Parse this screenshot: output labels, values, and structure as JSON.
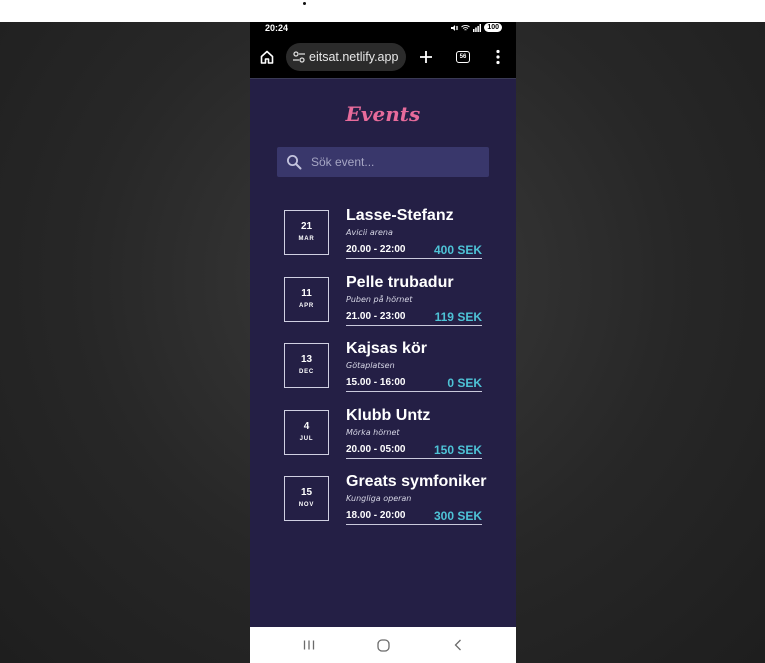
{
  "status_bar": {
    "time": "20:24",
    "battery": "100"
  },
  "browser": {
    "url": "eitsat.netlify.app",
    "tab_count": "56"
  },
  "page": {
    "heading": "Events",
    "search_placeholder": "Sök event..."
  },
  "events": [
    {
      "day": "21",
      "month": "MAR",
      "title": "Lasse-Stefanz",
      "venue": "Avicii arena",
      "time": "20.00 - 22:00",
      "price": "400 SEK"
    },
    {
      "day": "11",
      "month": "APR",
      "title": "Pelle trubadur",
      "venue": "Puben på hörnet",
      "time": "21.00 - 23:00",
      "price": "119 SEK"
    },
    {
      "day": "13",
      "month": "DEC",
      "title": "Kajsas kör",
      "venue": "Götaplatsen",
      "time": "15.00 - 16:00",
      "price": "0 SEK"
    },
    {
      "day": "4",
      "month": "JUL",
      "title": "Klubb Untz",
      "venue": "Mörka hörnet",
      "time": "20.00 - 05:00",
      "price": "150 SEK"
    },
    {
      "day": "15",
      "month": "NOV",
      "title": "Greats symfoniker",
      "venue": "Kungliga operan",
      "time": "18.00 - 20:00",
      "price": "300 SEK"
    }
  ],
  "icons": {
    "home": "home-icon",
    "site_settings": "tune-icon",
    "new_tab": "plus-icon",
    "menu": "more-vert-icon",
    "search": "search-icon",
    "nav_recents": "recents-icon",
    "nav_home": "circle-home-icon",
    "nav_back": "back-chevron-icon"
  },
  "colors": {
    "page_background": "#241f45",
    "heading": "#e76b9b",
    "price": "#4ec3d6",
    "search_background": "#39376b"
  }
}
